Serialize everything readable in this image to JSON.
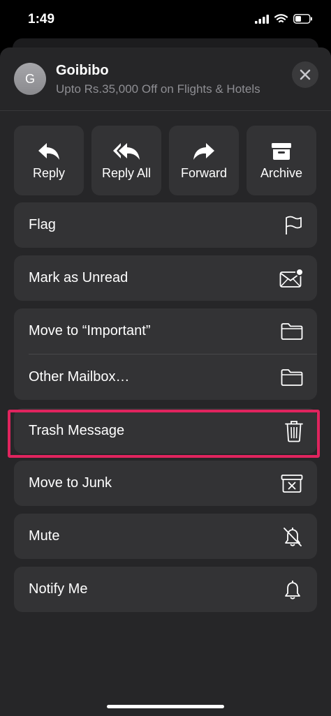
{
  "status": {
    "time": "1:49"
  },
  "header": {
    "avatar_initial": "G",
    "sender": "Goibibo",
    "subject": "Upto Rs.35,000 Off on Flights & Hotels"
  },
  "quick_actions": [
    {
      "label": "Reply",
      "icon": "reply-icon"
    },
    {
      "label": "Reply All",
      "icon": "reply-all-icon"
    },
    {
      "label": "Forward",
      "icon": "forward-icon"
    },
    {
      "label": "Archive",
      "icon": "archive-icon"
    }
  ],
  "menu": {
    "flag": "Flag",
    "mark_unread": "Mark as Unread",
    "move_important": "Move to “Important”",
    "other_mailbox": "Other Mailbox…",
    "trash": "Trash Message",
    "junk": "Move to Junk",
    "mute": "Mute",
    "notify": "Notify Me"
  },
  "colors": {
    "sheet_bg": "#262628",
    "button_bg": "#333335",
    "highlight": "#e0245e",
    "unread_dot": "#ffffff"
  }
}
